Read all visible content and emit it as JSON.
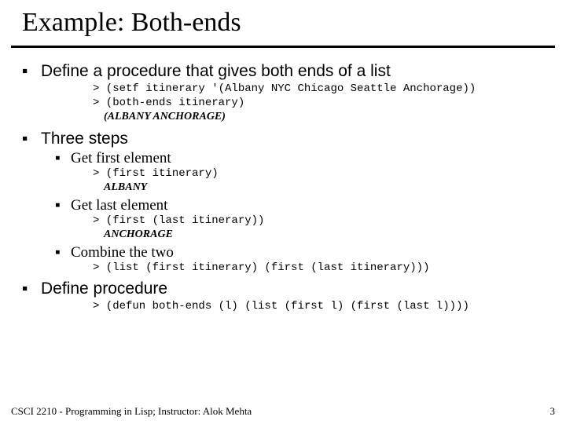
{
  "title": "Example: Both-ends",
  "bullets": {
    "define": "Define a procedure that gives both ends of a list",
    "define_code": "> (setf itinerary '(Albany NYC Chicago Seattle Anchorage))\n> (both-ends itinerary)",
    "define_result": "(ALBANY ANCHORAGE)",
    "three_steps": "Three steps",
    "get_first": "Get first element",
    "get_first_code": "> (first itinerary)",
    "get_first_result": "ALBANY",
    "get_last": "Get last element",
    "get_last_code": "> (first (last itinerary))",
    "get_last_result": "ANCHORAGE",
    "combine": "Combine the two",
    "combine_code": "> (list (first itinerary) (first (last itinerary)))",
    "define_proc": "Define procedure",
    "define_proc_code": "> (defun both-ends (l) (list (first l) (first (last l))))"
  },
  "footer": {
    "left": "CSCI 2210 - Programming in Lisp; Instructor: Alok Mehta",
    "page": "3"
  }
}
